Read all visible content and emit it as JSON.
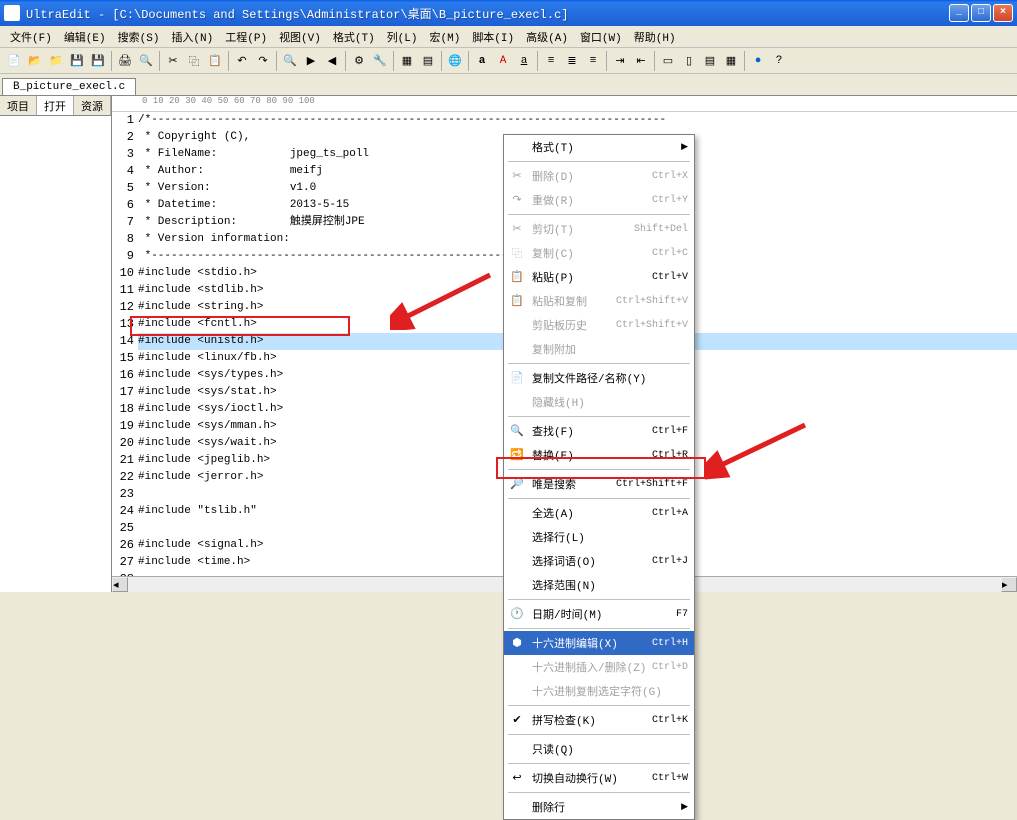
{
  "title": "UltraEdit - [C:\\Documents and Settings\\Administrator\\桌面\\B_picture_execl.c]",
  "win": {
    "min": "_",
    "max": "□",
    "close": "×"
  },
  "menu": [
    "文件(F)",
    "编辑(E)",
    "搜索(S)",
    "插入(N)",
    "工程(P)",
    "视图(V)",
    "格式(T)",
    "列(L)",
    "宏(M)",
    "脚本(I)",
    "高级(A)",
    "窗口(W)",
    "帮助(H)"
  ],
  "tab": "B_picture_execl.c",
  "side_tabs": [
    "项目",
    "打开",
    "资源管理"
  ],
  "ruler": "+----1----+----2----+----3----+----4----+----5----+----6----+----7----+----8----+----9----+----0----",
  "ruler_marks": [
    "0",
    "10",
    "20",
    "30",
    "40",
    "50",
    "60",
    "70",
    "80",
    "90",
    "100"
  ],
  "code": [
    "/*------------------------------------------------------------------------------",
    " * Copyright (C),",
    " * FileName:           jpeg_ts_poll",
    " * Author:             meifj",
    " * Version:            v1.0",
    " * Datetime:           2013-5-15",
    " * Description:        触摸屏控制JPE",
    " * Version information:",
    " *----------------------------------------------------------------------------*/",
    "#include <stdio.h>",
    "#include <stdlib.h>",
    "#include <string.h>",
    "#include <fcntl.h>",
    "#include <unistd.h>",
    "#include <linux/fb.h>",
    "#include <sys/types.h>",
    "#include <sys/stat.h>",
    "#include <sys/ioctl.h>",
    "#include <sys/mman.h>",
    "#include <sys/wait.h>",
    "#include <jpeglib.h>",
    "#include <jerror.h>",
    "",
    "#include \"tslib.h\"",
    "",
    "#include <signal.h>",
    "#include <time.h>",
    "",
    "#include <assert.h>"
  ],
  "selected_line_index": 13,
  "ctx": {
    "header": "格式(T)",
    "items": [
      {
        "label": "删除(D)",
        "sc": "Ctrl+X",
        "disabled": true,
        "icon": "✂"
      },
      {
        "label": "重做(R)",
        "sc": "Ctrl+Y",
        "disabled": true,
        "icon": "↷"
      },
      {
        "sep": true
      },
      {
        "label": "剪切(T)",
        "sc": "Shift+Del",
        "disabled": true,
        "icon": "✂"
      },
      {
        "label": "复制(C)",
        "sc": "Ctrl+C",
        "disabled": true,
        "icon": "⿻"
      },
      {
        "label": "粘贴(P)",
        "sc": "Ctrl+V",
        "disabled": false,
        "icon": "📋"
      },
      {
        "label": "粘贴和复制",
        "sc": "Ctrl+Shift+V",
        "disabled": true,
        "icon": "📋"
      },
      {
        "label": "剪贴板历史",
        "sc": "Ctrl+Shift+V",
        "disabled": true,
        "icon": ""
      },
      {
        "label": "复制附加",
        "sc": "",
        "disabled": true,
        "icon": ""
      },
      {
        "sep": true
      },
      {
        "label": "复制文件路径/名称(Y)",
        "sc": "",
        "icon": "📄"
      },
      {
        "label": "隐藏线(H)",
        "sc": "",
        "disabled": true
      },
      {
        "sep": true
      },
      {
        "label": "查找(F)",
        "sc": "Ctrl+F",
        "icon": "🔍"
      },
      {
        "label": "替换(E)",
        "sc": "Ctrl+R",
        "icon": "🔁"
      },
      {
        "sep": true
      },
      {
        "label": "唯是搜索",
        "sc": "Ctrl+Shift+F",
        "icon": "🔎"
      },
      {
        "sep": true
      },
      {
        "label": "全选(A)",
        "sc": "Ctrl+A",
        "icon": ""
      },
      {
        "label": "选择行(L)",
        "sc": "",
        "icon": ""
      },
      {
        "label": "选择词语(O)",
        "sc": "Ctrl+J",
        "icon": ""
      },
      {
        "label": "选择范围(N)",
        "sc": "",
        "icon": ""
      },
      {
        "sep": true
      },
      {
        "label": "日期/时间(M)",
        "sc": "F7",
        "icon": "🕐"
      },
      {
        "sep": true
      },
      {
        "label": "十六进制编辑(X)",
        "sc": "Ctrl+H",
        "icon": "⬢",
        "selected": true
      },
      {
        "label": "十六进制插入/删除(Z)",
        "sc": "Ctrl+D",
        "disabled": true,
        "icon": ""
      },
      {
        "label": "十六进制复制选定字符(G)",
        "sc": "",
        "disabled": true
      },
      {
        "sep": true
      },
      {
        "label": "拼写检查(K)",
        "sc": "Ctrl+K",
        "icon": "✔"
      },
      {
        "sep": true
      },
      {
        "label": "只读(Q)",
        "sc": "",
        "icon": ""
      },
      {
        "sep": true
      },
      {
        "label": "切换自动换行(W)",
        "sc": "Ctrl+W",
        "icon": "↩"
      },
      {
        "sep": true
      },
      {
        "label": "删除行",
        "arrow": true
      }
    ]
  }
}
